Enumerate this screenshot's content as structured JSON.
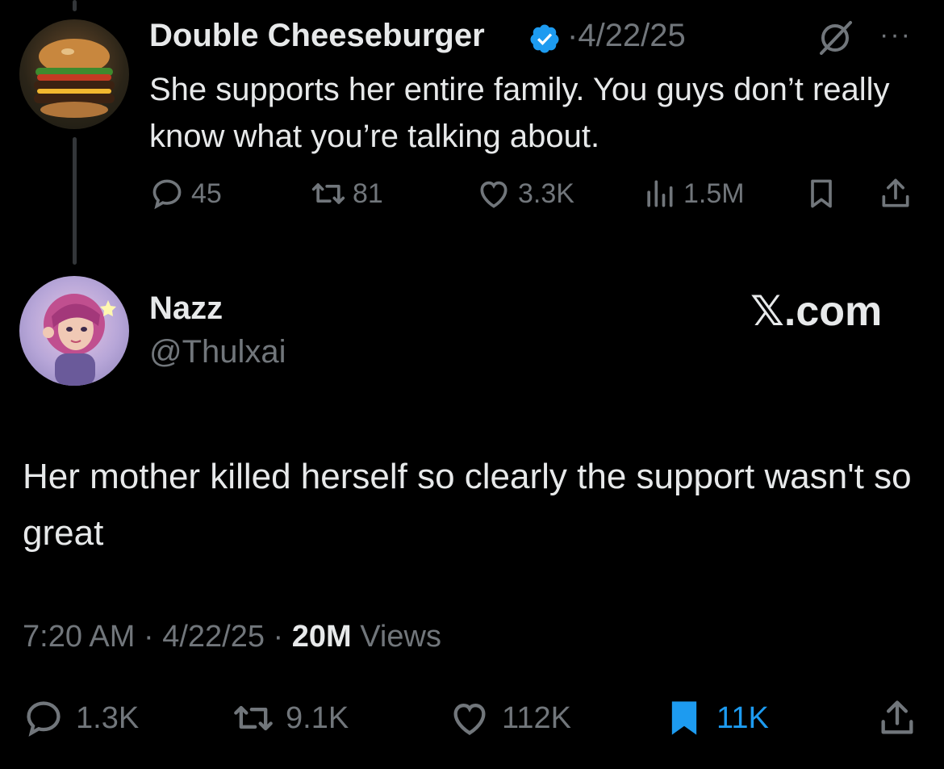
{
  "reply_tweet": {
    "author_name": "Double Cheeseburger",
    "separator": "·",
    "date": "4/22/25",
    "more_label": "···",
    "text": "She supports her entire family. You guys don’t really know what you’re talking about.",
    "stats": {
      "replies": "45",
      "reposts": "81",
      "likes": "3.3K",
      "views": "1.5M"
    }
  },
  "main_tweet": {
    "author_name": "Nazz",
    "handle": "@Thulxai",
    "watermark": "𝕏.com",
    "text": "Her mother killed herself so clearly the support wasn't so great",
    "time": "7:20 AM",
    "date": "4/22/25",
    "views_count": "20M",
    "views_label": "Views",
    "stats": {
      "replies": "1.3K",
      "reposts": "9.1K",
      "likes": "112K",
      "bookmarks": "11K"
    }
  },
  "colors": {
    "background": "#000000",
    "text": "#e7e9ea",
    "muted": "#71767b",
    "accent": "#1d9bf0"
  },
  "icons": [
    "verified-badge-icon",
    "grok-icon",
    "more-icon",
    "reply-icon",
    "repost-icon",
    "like-icon",
    "views-icon",
    "bookmark-icon",
    "share-icon"
  ]
}
